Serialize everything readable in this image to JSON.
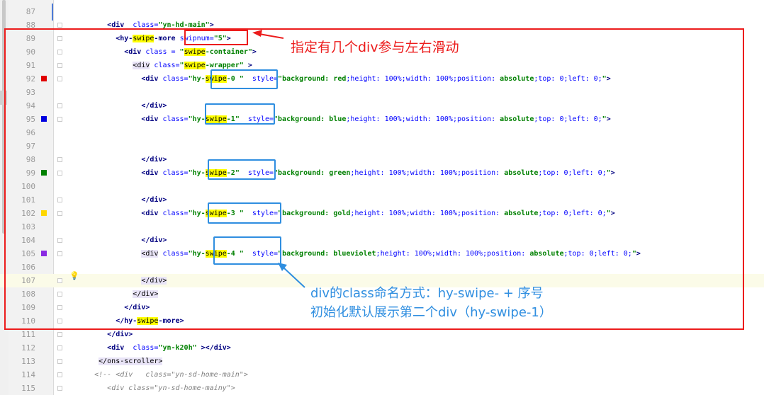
{
  "lines": [
    {
      "num": "87",
      "segs": []
    },
    {
      "num": "88",
      "segs": [
        [
          "",
          "        "
        ],
        [
          "tag",
          "<div"
        ],
        [
          "",
          "  "
        ],
        [
          "attr",
          "class="
        ],
        [
          "str",
          "\"yn-hd-main\""
        ],
        [
          "tag",
          ">"
        ]
      ]
    },
    {
      "num": "89",
      "segs": [
        [
          "",
          "          "
        ],
        [
          "tag",
          "<hy-"
        ],
        [
          "hl",
          "swipe"
        ],
        [
          "tag",
          "-more"
        ],
        [
          "",
          " "
        ],
        [
          "attr",
          "swipnum="
        ],
        [
          "str",
          "\"5\""
        ],
        [
          "tag",
          ">"
        ]
      ]
    },
    {
      "num": "90",
      "segs": [
        [
          "",
          "            "
        ],
        [
          "tag",
          "<div"
        ],
        [
          "",
          " "
        ],
        [
          "attr",
          "class = "
        ],
        [
          "str",
          "\""
        ],
        [
          "hl",
          "swipe"
        ],
        [
          "str",
          "-container\""
        ],
        [
          "tag",
          ">"
        ]
      ]
    },
    {
      "num": "91",
      "segs": [
        [
          "",
          "              "
        ],
        [
          "tagbg",
          "<div"
        ],
        [
          "",
          " "
        ],
        [
          "attr",
          "class="
        ],
        [
          "str",
          "\""
        ],
        [
          "hl",
          "swipe"
        ],
        [
          "str",
          "-wrapper\""
        ],
        [
          "",
          " "
        ],
        [
          "tag",
          ">"
        ]
      ]
    },
    {
      "num": "92",
      "segs": [
        [
          "",
          "                "
        ],
        [
          "tag",
          "<div"
        ],
        [
          "",
          " "
        ],
        [
          "attr",
          "class="
        ],
        [
          "str",
          "\"hy-"
        ],
        [
          "hl",
          "swipe"
        ],
        [
          "str",
          "-0 \""
        ],
        [
          "",
          "  "
        ],
        [
          "attr",
          "style="
        ],
        [
          "str",
          "\"background: "
        ],
        [
          "str",
          "red"
        ],
        [
          "attr",
          ";height: "
        ],
        [
          "attr",
          "100%"
        ],
        [
          "attr",
          ";width: "
        ],
        [
          "attr",
          "100%"
        ],
        [
          "attr",
          ";position: "
        ],
        [
          "str",
          "absolute"
        ],
        [
          "attr",
          ";top: 0;left: 0;"
        ],
        [
          "str",
          "\""
        ],
        [
          "tag",
          ">"
        ]
      ]
    },
    {
      "num": "93",
      "segs": []
    },
    {
      "num": "94",
      "segs": [
        [
          "",
          "                "
        ],
        [
          "tag",
          "</div>"
        ]
      ]
    },
    {
      "num": "95",
      "segs": [
        [
          "",
          "                "
        ],
        [
          "tag",
          "<div"
        ],
        [
          "",
          " "
        ],
        [
          "attr",
          "class="
        ],
        [
          "str",
          "\"hy-"
        ],
        [
          "hl",
          "swipe"
        ],
        [
          "str",
          "-1\""
        ],
        [
          "",
          "  "
        ],
        [
          "attr",
          "style="
        ],
        [
          "str",
          "\"background: "
        ],
        [
          "str",
          "blue"
        ],
        [
          "attr",
          ";height: "
        ],
        [
          "attr",
          "100%"
        ],
        [
          "attr",
          ";width: "
        ],
        [
          "attr",
          "100%"
        ],
        [
          "attr",
          ";position: "
        ],
        [
          "str",
          "absolute"
        ],
        [
          "attr",
          ";top: 0;left: 0;"
        ],
        [
          "str",
          "\""
        ],
        [
          "tag",
          ">"
        ]
      ]
    },
    {
      "num": "96",
      "segs": []
    },
    {
      "num": "97",
      "segs": []
    },
    {
      "num": "98",
      "segs": [
        [
          "",
          "                "
        ],
        [
          "tag",
          "</div>"
        ]
      ]
    },
    {
      "num": "99",
      "segs": [
        [
          "",
          "                "
        ],
        [
          "tag",
          "<div"
        ],
        [
          "",
          " "
        ],
        [
          "attr",
          "class="
        ],
        [
          "str",
          "\"hy-"
        ],
        [
          "hl",
          "swipe"
        ],
        [
          "str",
          "-2\""
        ],
        [
          "",
          "  "
        ],
        [
          "attr",
          "style="
        ],
        [
          "str",
          "\"background: "
        ],
        [
          "str",
          "green"
        ],
        [
          "attr",
          ";height: "
        ],
        [
          "attr",
          "100%"
        ],
        [
          "attr",
          ";width: "
        ],
        [
          "attr",
          "100%"
        ],
        [
          "attr",
          ";position: "
        ],
        [
          "str",
          "absolute"
        ],
        [
          "attr",
          ";top: 0;left: 0;"
        ],
        [
          "str",
          "\""
        ],
        [
          "tag",
          ">"
        ]
      ]
    },
    {
      "num": "100",
      "segs": []
    },
    {
      "num": "101",
      "segs": [
        [
          "",
          "                "
        ],
        [
          "tag",
          "</div>"
        ]
      ]
    },
    {
      "num": "102",
      "segs": [
        [
          "",
          "                "
        ],
        [
          "tag",
          "<div"
        ],
        [
          "",
          " "
        ],
        [
          "attr",
          "class="
        ],
        [
          "str",
          "\"hy-"
        ],
        [
          "hl",
          "swipe"
        ],
        [
          "str",
          "-3 \""
        ],
        [
          "",
          "  "
        ],
        [
          "attr",
          "style="
        ],
        [
          "str",
          "\"background: "
        ],
        [
          "str",
          "gold"
        ],
        [
          "attr",
          ";height: "
        ],
        [
          "attr",
          "100%"
        ],
        [
          "attr",
          ";width: "
        ],
        [
          "attr",
          "100%"
        ],
        [
          "attr",
          ";position: "
        ],
        [
          "str",
          "absolute"
        ],
        [
          "attr",
          ";top: 0;left: 0;"
        ],
        [
          "str",
          "\""
        ],
        [
          "tag",
          ">"
        ]
      ]
    },
    {
      "num": "103",
      "segs": []
    },
    {
      "num": "104",
      "segs": [
        [
          "",
          "                "
        ],
        [
          "tag",
          "</div>"
        ]
      ]
    },
    {
      "num": "105",
      "segs": [
        [
          "",
          "                "
        ],
        [
          "tagbg",
          "<div"
        ],
        [
          "",
          " "
        ],
        [
          "attr",
          "class="
        ],
        [
          "str",
          "\"hy-"
        ],
        [
          "hl",
          "swipe"
        ],
        [
          "str",
          "-4 \""
        ],
        [
          "",
          "  "
        ],
        [
          "attr",
          "style="
        ],
        [
          "str",
          "\"background: "
        ],
        [
          "str",
          "blueviolet"
        ],
        [
          "attr",
          ";height: "
        ],
        [
          "attr",
          "100%"
        ],
        [
          "attr",
          ";width: "
        ],
        [
          "attr",
          "100%"
        ],
        [
          "attr",
          ";position: "
        ],
        [
          "str",
          "absolute"
        ],
        [
          "attr",
          ";top: 0;left: 0;"
        ],
        [
          "str",
          "\""
        ],
        [
          "tag",
          ">"
        ]
      ]
    },
    {
      "num": "106",
      "segs": []
    },
    {
      "num": "107",
      "segs": [
        [
          "",
          "                "
        ],
        [
          "tagbg",
          "</div>"
        ]
      ]
    },
    {
      "num": "108",
      "segs": [
        [
          "",
          "              "
        ],
        [
          "tagbg",
          "</div>"
        ]
      ]
    },
    {
      "num": "109",
      "segs": [
        [
          "",
          "            "
        ],
        [
          "tag",
          "</div>"
        ]
      ]
    },
    {
      "num": "110",
      "segs": [
        [
          "",
          "          "
        ],
        [
          "tag",
          "</hy-"
        ],
        [
          "hl",
          "swipe"
        ],
        [
          "tag",
          "-more>"
        ]
      ]
    },
    {
      "num": "111",
      "segs": [
        [
          "",
          "        "
        ],
        [
          "tag",
          "</div>"
        ]
      ]
    },
    {
      "num": "112",
      "segs": [
        [
          "",
          "        "
        ],
        [
          "tag",
          "<div"
        ],
        [
          "",
          "  "
        ],
        [
          "attr",
          "class="
        ],
        [
          "str",
          "\"yn-k20h\""
        ],
        [
          "",
          " "
        ],
        [
          "tag",
          "></div>"
        ]
      ]
    },
    {
      "num": "113",
      "segs": [
        [
          "",
          "      "
        ],
        [
          "tagbg",
          "</ons-scroller>"
        ]
      ]
    },
    {
      "num": "114",
      "segs": [
        [
          "",
          "     "
        ],
        [
          "comment",
          "<!-- <div   class=\"yn-sd-home-main\">"
        ]
      ]
    },
    {
      "num": "115",
      "segs": [
        [
          "",
          "        "
        ],
        [
          "comment",
          "<div class=\"yn-sd-home-mainy\">"
        ]
      ]
    }
  ],
  "markers": [
    {
      "line": "92",
      "color": "#e00000"
    },
    {
      "line": "95",
      "color": "#0000e0"
    },
    {
      "line": "99",
      "color": "#008000"
    },
    {
      "line": "102",
      "color": "#ffd700"
    },
    {
      "line": "105",
      "color": "#8a2be2"
    }
  ],
  "current_line": "107",
  "bulb_icon": "lightbulb-icon",
  "annotations": {
    "swipnum_note": "指定有几个div参与左右滑动",
    "class_note_line1": "div的class命名方式：hy-swipe- + 序号",
    "class_note_line2": "初始化默认展示第二个div（hy-swipe-1）"
  },
  "colors": {
    "annotation_red": "#ec1c1c",
    "annotation_blue": "#2f8ee0"
  }
}
